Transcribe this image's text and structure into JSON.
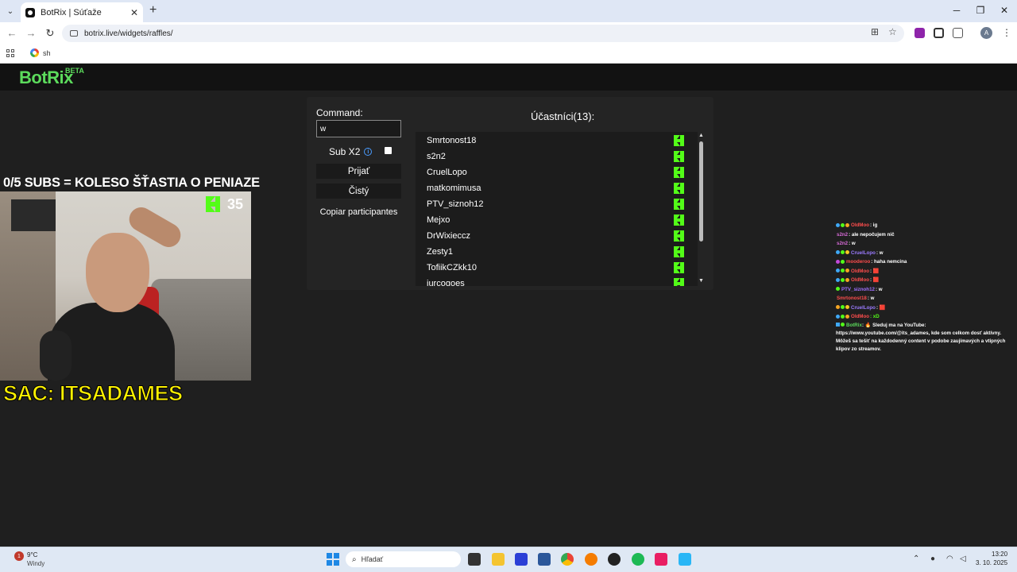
{
  "browser": {
    "tab_title": "BotRix | Súťaže",
    "tab_close": "✕",
    "new_tab": "+",
    "url": "botrix.live/widgets/raffles/",
    "bookmark_label": "sh",
    "profile_initial": "A"
  },
  "header": {
    "logo": "BotRix",
    "beta": "BETA"
  },
  "raffle": {
    "command_label": "Command:",
    "command_value": "w",
    "subx2_label": "Sub X2",
    "subx2_checked": false,
    "accept_label": "Prijať",
    "clear_label": "Čistý",
    "copy_label": "Copiar participantes",
    "participants_title": "Účastníci(13):",
    "participants": [
      "Smrtonost18",
      "s2n2",
      "CruelLopo",
      "matkomimusa",
      "PTV_siznoh12",
      "Mejxo",
      "DrWixieccz",
      "Zesty1",
      "TofiikCZkk10",
      "jurcogoes"
    ]
  },
  "overlay": {
    "title": "0/5 SUBS = KOLESO ŠŤASTIA O PENIAZE",
    "kick_count": "35",
    "sac": "SAC: ITSADAMES"
  },
  "chat": [
    {
      "user": "OldMoo",
      "user_color": "#ff4d4d",
      "msg": ": ig"
    },
    {
      "user": "s2n2",
      "user_color": "#d96bd9",
      "msg": ": ale nepočujem nič"
    },
    {
      "user": "s2n2",
      "user_color": "#d96bd9",
      "msg": ": w"
    },
    {
      "user": "CruelLopo",
      "user_color": "#9b7bff",
      "msg": ": w"
    },
    {
      "user": "mooderoo",
      "user_color": "#ff4d4d",
      "msg": ": haha nemcina"
    },
    {
      "user": "OldMoo",
      "user_color": "#ff4d4d",
      "msg": ": 🟥"
    },
    {
      "user": "OldMoo",
      "user_color": "#ff4d4d",
      "msg": ": 🟥"
    },
    {
      "user": "PTV_siznoh12",
      "user_color": "#a070ff",
      "msg": ": w"
    },
    {
      "user": "Smrtonost18",
      "user_color": "#ff4d4d",
      "msg": ": w"
    },
    {
      "user": "CruelLopo",
      "user_color": "#9b7bff",
      "msg": ": 🟥"
    },
    {
      "user": "OldMoo",
      "user_color": "#ff4d4d",
      "msg": ": xD"
    }
  ],
  "chat_bot": {
    "user": "BotRix",
    "msg": ": 🔥 Sleduj ma na YouTube: https://www.youtube.com/@its_adames, kde som celkom dosť aktívny. Môžeš sa tešiť na každodenný content v podobe zaujímavých a vtipných klipov zo streamov."
  },
  "taskbar": {
    "weather_badge": "1",
    "weather_temp": "9°C",
    "weather_desc": "Windy",
    "search_placeholder": "Hľadať",
    "time": "13:20",
    "date": "3. 10. 2025"
  },
  "colors": {
    "brand_green": "#5cdb5c",
    "kick_green": "#53fc18",
    "panel_bg": "#242424",
    "page_bg": "#1f1f1f",
    "sac_yellow": "#fff200"
  }
}
